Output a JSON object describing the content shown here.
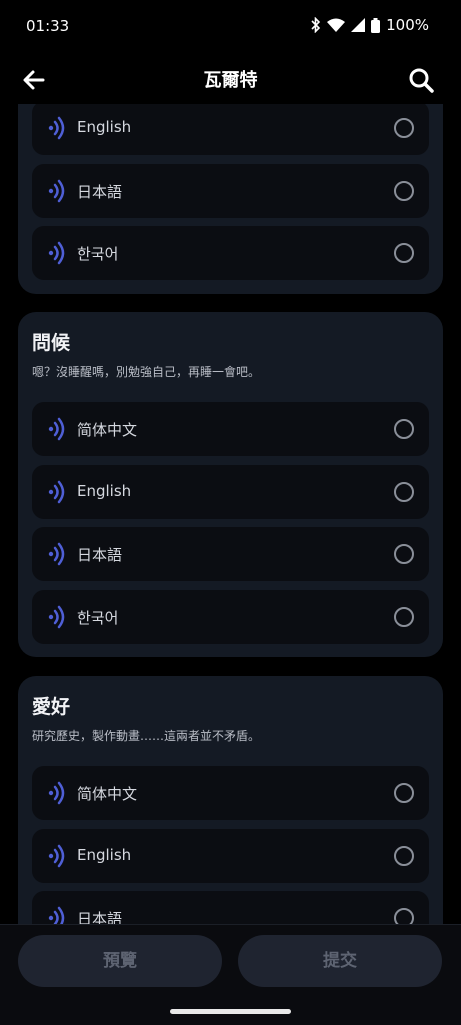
{
  "status": {
    "time": "01:33",
    "battery": "100%"
  },
  "header": {
    "title": "瓦爾特"
  },
  "cards": [
    {
      "title": "",
      "subtitle": "",
      "options": [
        {
          "label": "English"
        },
        {
          "label": "日本語"
        },
        {
          "label": "한국어"
        }
      ]
    },
    {
      "title": "問候",
      "subtitle": "嗯？沒睡醒嗎，別勉強自己，再睡一會吧。",
      "options": [
        {
          "label": "简体中文"
        },
        {
          "label": "English"
        },
        {
          "label": "日本語"
        },
        {
          "label": "한국어"
        }
      ]
    },
    {
      "title": "愛好",
      "subtitle": "研究歷史，製作動畫……這兩者並不矛盾。",
      "options": [
        {
          "label": "简体中文"
        },
        {
          "label": "English"
        },
        {
          "label": "日本語"
        }
      ]
    }
  ],
  "footer": {
    "preview_label": "預覽",
    "submit_label": "提交"
  },
  "colors": {
    "accent": "#4f5fd6",
    "card": "#141a24",
    "row": "#0b0d12",
    "button": "#1f2430"
  }
}
